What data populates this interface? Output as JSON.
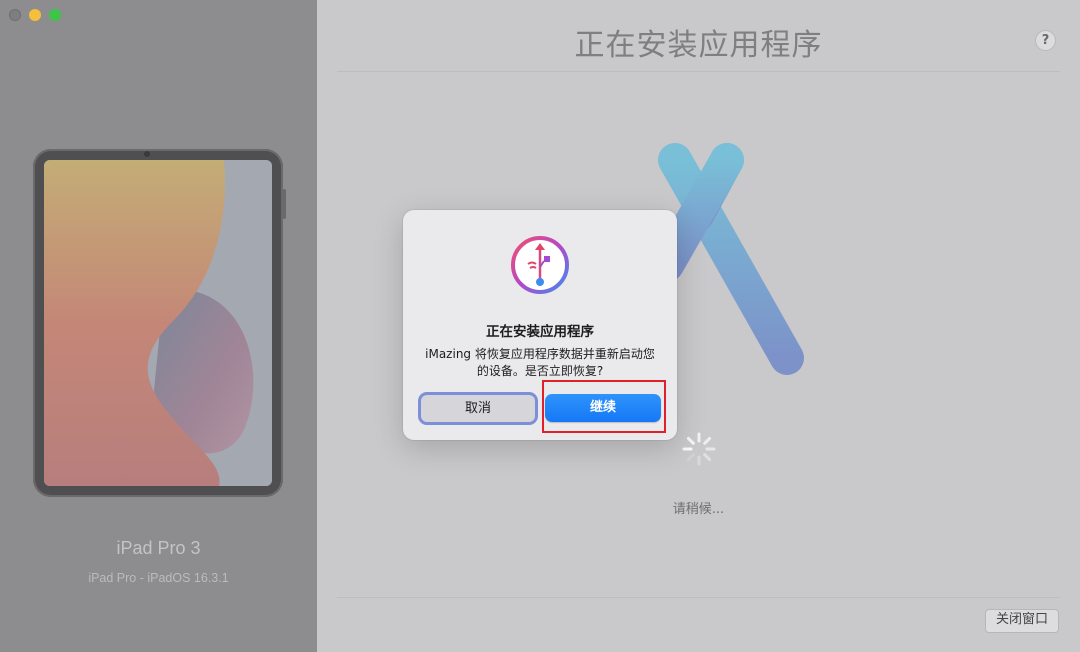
{
  "window": {
    "title": "正在安装应用程序",
    "help_label": "?",
    "close_window_label": "关闭窗口"
  },
  "sidebar": {
    "device_name": "iPad Pro 3",
    "device_details": "iPad Pro - iPadOS 16.3.1"
  },
  "main": {
    "status_text": "请稍候...",
    "icon": "app-store-icon"
  },
  "dialog": {
    "title": "正在安装应用程序",
    "message_line1": "iMazing 将恢复应用程序数据并重新启动您",
    "message_line2": "的设备。是否立即恢复?",
    "cancel_label": "取消",
    "continue_label": "继续",
    "icon": "imazing-icon"
  },
  "colors": {
    "accent": "#1678f6",
    "highlight": "#e0212a",
    "close": "#7e7d80",
    "minimize": "#f5be3b",
    "maximize": "#3cc547"
  }
}
